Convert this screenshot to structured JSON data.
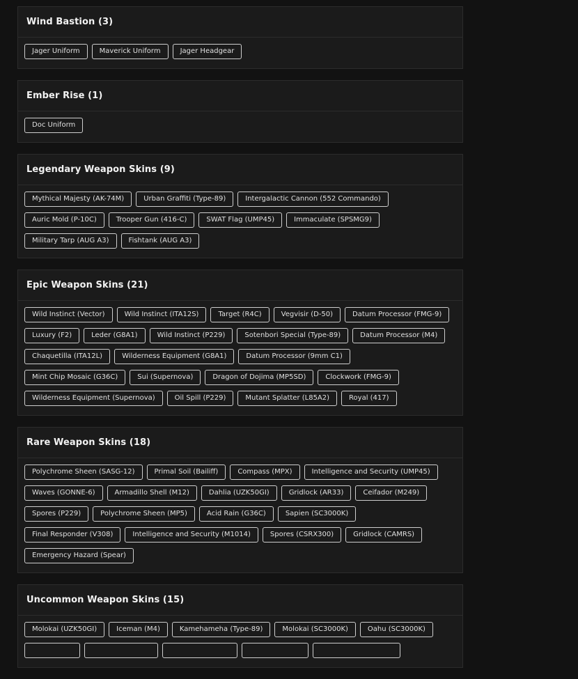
{
  "sections": [
    {
      "title": "Wind Bastion (3)",
      "items": [
        "Jager Uniform",
        "Maverick Uniform",
        "Jager Headgear"
      ]
    },
    {
      "title": "Ember Rise (1)",
      "items": [
        "Doc Uniform"
      ]
    },
    {
      "title": "Legendary Weapon Skins (9)",
      "items": [
        "Mythical Majesty (AK-74M)",
        "Urban Graffiti (Type-89)",
        "Intergalactic Cannon (552 Commando)",
        "Auric Mold (P-10C)",
        "Trooper Gun (416-C)",
        "SWAT Flag (UMP45)",
        "Immaculate (SPSMG9)",
        "Military Tarp (AUG A3)",
        "Fishtank (AUG A3)"
      ]
    },
    {
      "title": "Epic Weapon Skins (21)",
      "items": [
        "Wild Instinct (Vector)",
        "Wild Instinct (ITA12S)",
        "Target (R4C)",
        "Vegvisir (D-50)",
        "Datum Processor (FMG-9)",
        "Luxury (F2)",
        "Leder (G8A1)",
        "Wild Instinct (P229)",
        "Sotenbori Special (Type-89)",
        "Datum Processor (M4)",
        "Chaquetilla (ITA12L)",
        "Wilderness Equipment (G8A1)",
        "Datum Processor (9mm C1)",
        "Mint Chip Mosaic (G36C)",
        "Sui (Supernova)",
        "Dragon of Dojima (MP5SD)",
        "Clockwork (FMG-9)",
        "Wilderness Equipment (Supernova)",
        "Oil Spill (P229)",
        "Mutant Splatter (L85A2)",
        "Royal (417)"
      ]
    },
    {
      "title": "Rare Weapon Skins (18)",
      "items": [
        "Polychrome Sheen (SASG-12)",
        "Primal Soil (Bailiff)",
        "Compass (MPX)",
        "Intelligence and Security (UMP45)",
        "Waves (GONNE-6)",
        "Armadillo Shell (M12)",
        "Dahlia (UZK50GI)",
        "Gridlock (AR33)",
        "Ceifador (M249)",
        "Spores (P229)",
        "Polychrome Sheen (MP5)",
        "Acid Rain (G36C)",
        "Sapien (SC3000K)",
        "Final Responder (V308)",
        "Intelligence and Security (M1014)",
        "Spores (CSRX300)",
        "Gridlock (CAMRS)",
        "Emergency Hazard (Spear)"
      ]
    },
    {
      "title": "Uncommon Weapon Skins (15)",
      "items": [
        "Molokai (UZK50GI)",
        "Iceman (M4)",
        "Kamehameha (Type-89)",
        "Molokai (SC3000K)",
        "Oahu (SC3000K)"
      ],
      "partial_row_count": 5
    }
  ]
}
